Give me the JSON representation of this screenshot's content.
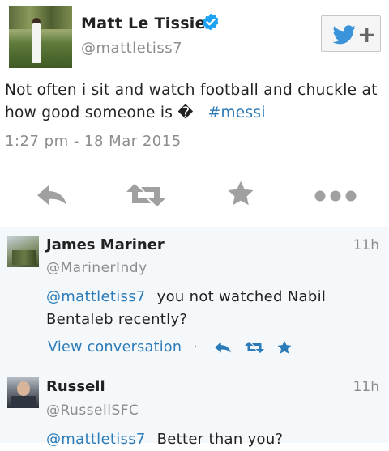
{
  "tweet": {
    "author_name": "Matt  Le  Tissier",
    "author_handle": "@mattletiss7",
    "text": "Not often i sit and watch football and chuckle at how good someone is �",
    "hashtag": "#messi",
    "timestamp": "1:27 pm - 18 Mar 2015"
  },
  "actions": {
    "reply": "reply-icon",
    "retweet": "retweet-icon",
    "favorite": "favorite-icon",
    "more": "more-icon"
  },
  "replies": [
    {
      "name": "James  Mariner",
      "handle": "@MarinerIndy",
      "time": "11h",
      "mention": "@mattletiss7",
      "text": "you not watched Nabil Bentaleb recently?",
      "view_conversation": "View conversation"
    },
    {
      "name": "Russell",
      "handle": "@RussellSFC",
      "time": "11h",
      "mention": "@mattletiss7",
      "text": "Better than you?"
    }
  ],
  "colors": {
    "link": "#2b7bb9",
    "verified": "#1da1f2",
    "icon_gray": "#a0a0a0"
  }
}
